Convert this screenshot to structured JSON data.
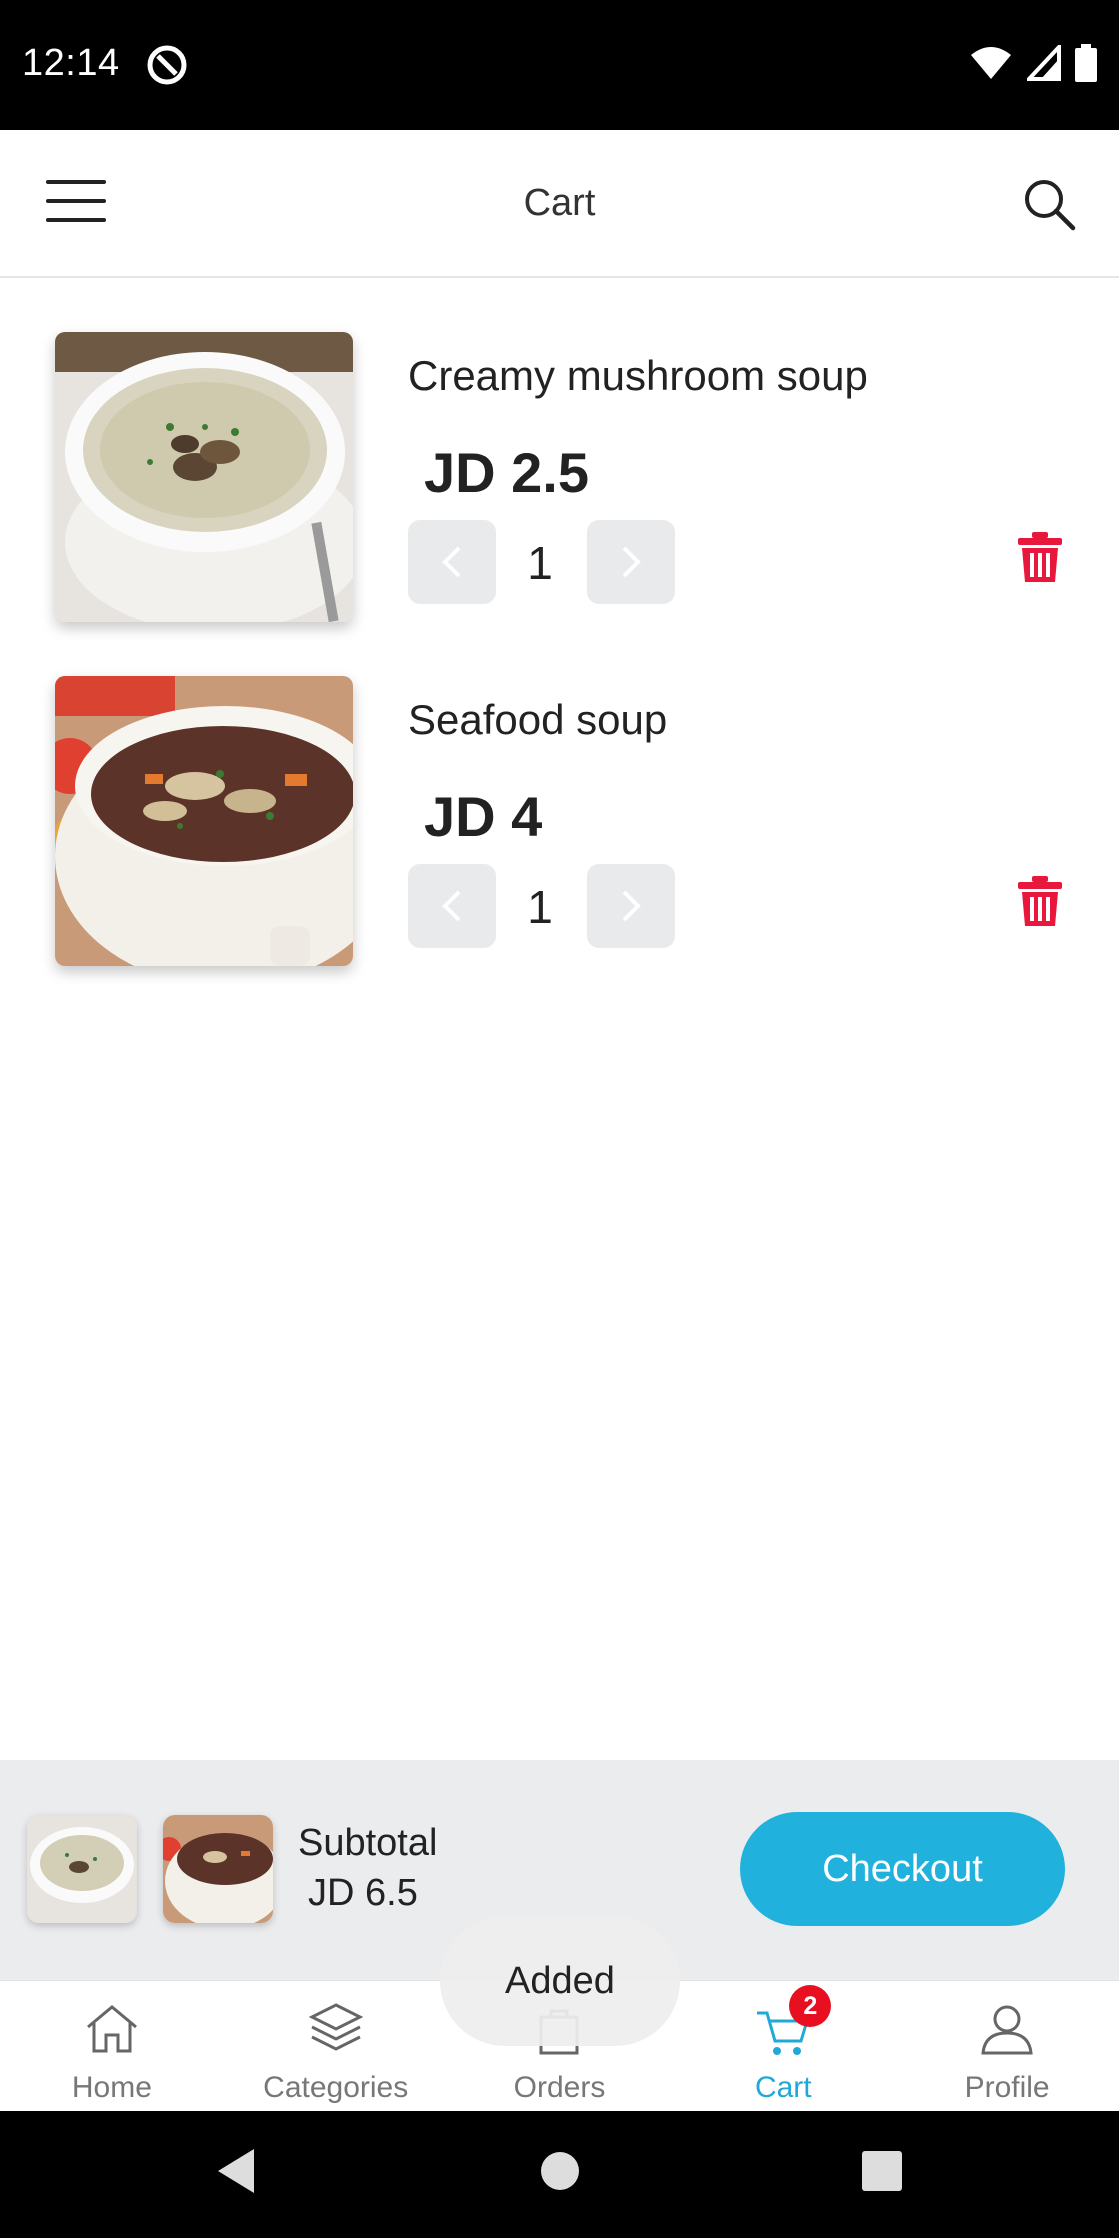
{
  "status_bar": {
    "time": "12:14"
  },
  "app_bar": {
    "title": "Cart"
  },
  "cart": {
    "items": [
      {
        "name": "Creamy mushroom soup",
        "price": "JD 2.5",
        "quantity": "1"
      },
      {
        "name": "Seafood soup",
        "price": "JD 4",
        "quantity": "1"
      }
    ]
  },
  "summary": {
    "subtotal_label": "Subtotal",
    "subtotal_value": "JD 6.5",
    "checkout_label": "Checkout"
  },
  "bottom_nav": {
    "items": [
      {
        "label": "Home",
        "icon": "home-icon"
      },
      {
        "label": "Categories",
        "icon": "layers-icon"
      },
      {
        "label": "Orders",
        "icon": "bag-icon"
      },
      {
        "label": "Cart",
        "icon": "cart-icon",
        "active": true,
        "badge": "2"
      },
      {
        "label": "Profile",
        "icon": "user-icon"
      }
    ]
  },
  "toast": {
    "text": "Added"
  },
  "colors": {
    "accent": "#20b2dc",
    "delete": "#e8183c",
    "badge": "#e81020",
    "summary_bg": "#ebecee"
  }
}
